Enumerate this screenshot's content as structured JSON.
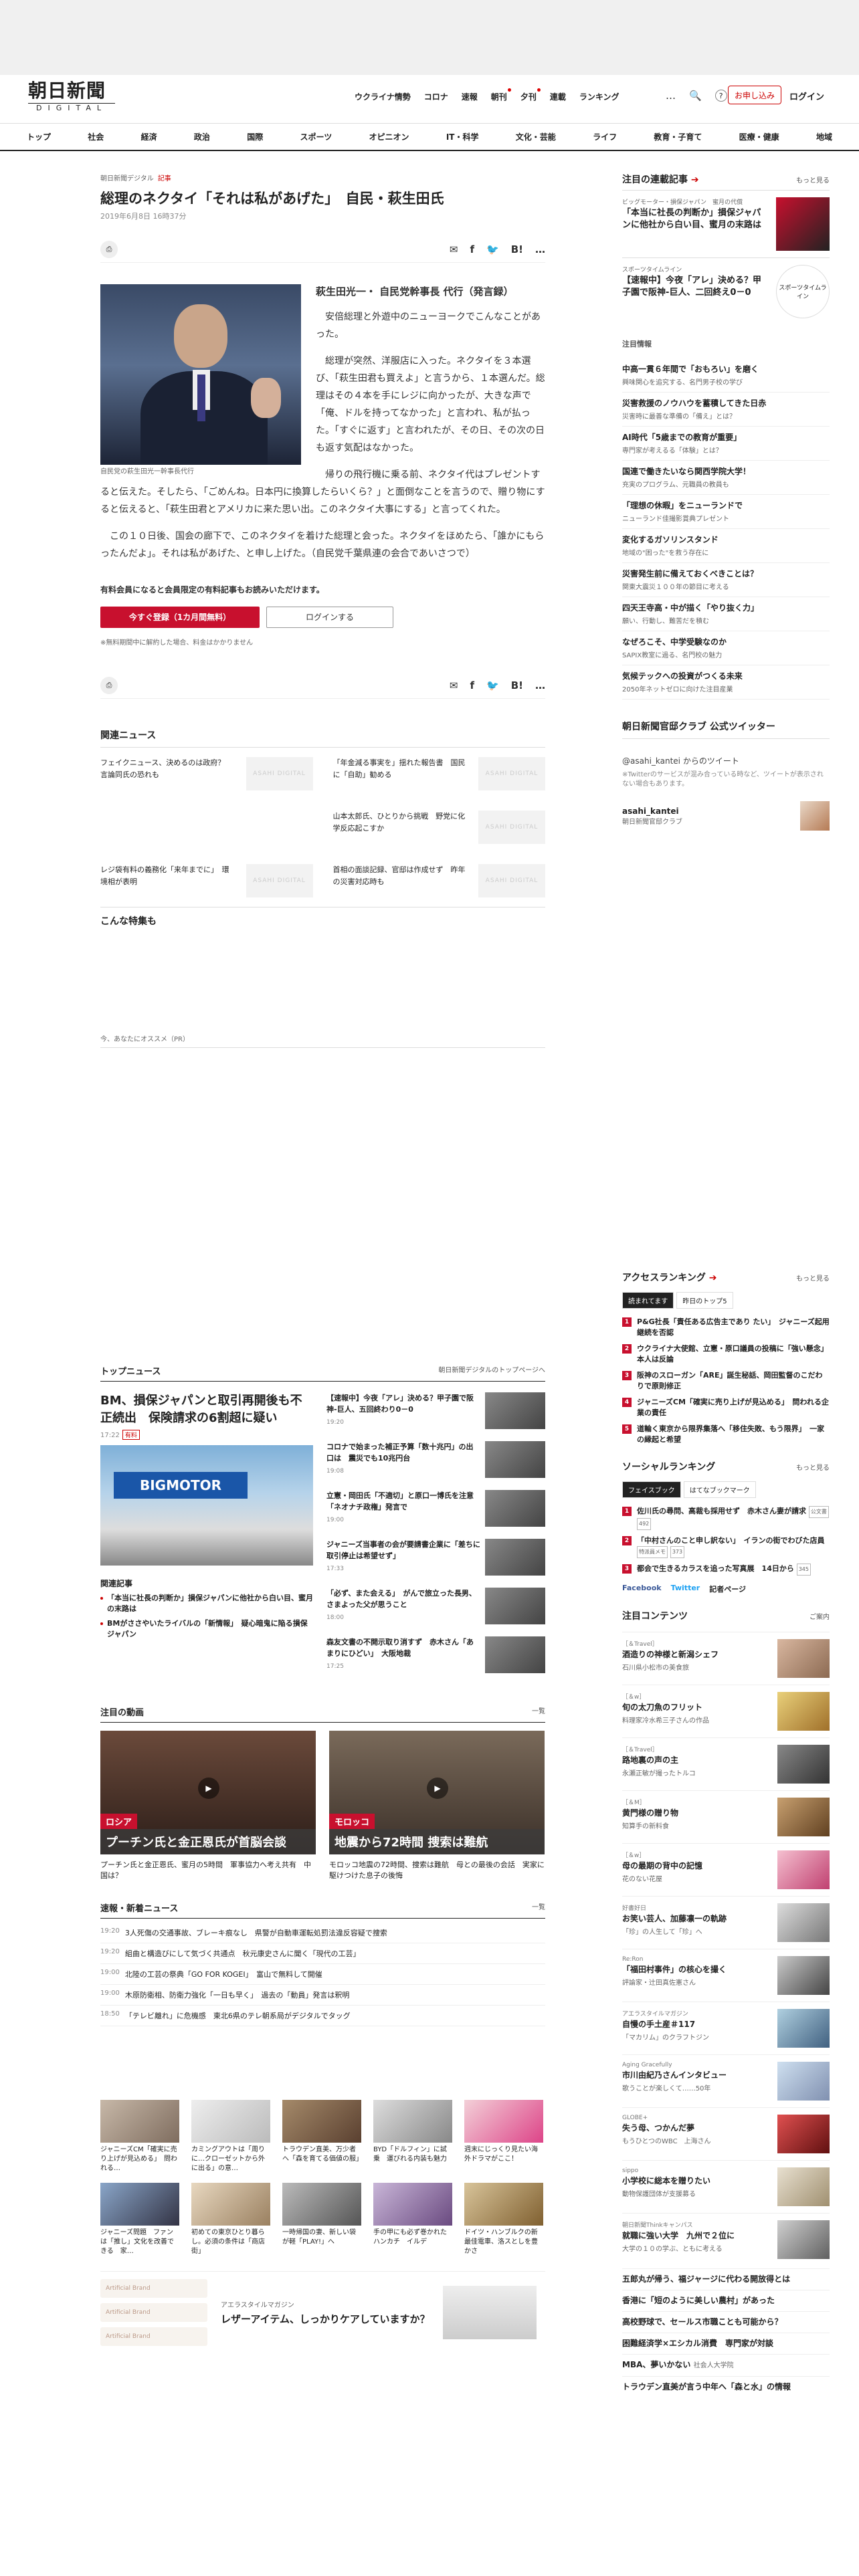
{
  "header": {
    "logo_main": "朝日新聞",
    "logo_sub": "DIGITAL",
    "nav": [
      "ウクライナ情勢",
      "コロナ",
      "速報",
      "朝刊",
      "夕刊",
      "連載",
      "ランキング"
    ],
    "more": "…",
    "search_icon": "🔍",
    "help_icon": "?",
    "signup": "お申し込み",
    "login": "ログイン"
  },
  "catnav": [
    "トップ",
    "社会",
    "経済",
    "政治",
    "国際",
    "スポーツ",
    "オピニオン",
    "IT・科学",
    "文化・芸能",
    "ライフ",
    "教育・子育て",
    "医療・健康",
    "地域"
  ],
  "article": {
    "crumb": "朝日新聞デジタル",
    "crumb_kind": "記事",
    "title": "総理のネクタイ「それは私があげた」　自民・萩生田氏",
    "date": "2019年6月8日 16時37分",
    "share": {
      "print": "⎙",
      "mail": "✉",
      "fb": "f",
      "tw": "🐦",
      "hatena": "B!",
      "more": "…",
      "list": "list"
    },
    "photo_caption": "自民党の萩生田光一幹事長代行",
    "subhead": "萩生田光一・ 自民党幹事長 代行（発言録）",
    "paragraphs": [
      "安倍総理と外遊中のニューヨークでこんなことがあった。",
      "総理が突然、洋服店に入った。ネクタイを３本選び、「萩生田君も買えよ」と言うから、１本選んだ。総理はその４本を手にレジに向かったが、大きな声で「俺、ドルを持ってなかった」と言われ、私が払った。「すぐに返す」と言われたが、その日、その次の日も返す気配はなかった。",
      "帰りの飛行機に乗る前、ネクタイ代はプレゼントすると伝えた。そしたら、「ごめんね。日本円に換算したらいくら？」と面倒なことを言うので、贈り物にすると伝えると、「萩生田君とアメリカに来た思い出。このネクタイ大事にする」と言ってくれた。",
      "この１０日後、国会の廊下で、このネクタイを着けた総理と会った。ネクタイをほめたら、「誰かにもらったんだよ」。それは私があげた、と申し上げた。（自民党千葉県連の会合であいさつで）"
    ],
    "paywall": {
      "msg": "有料会員になると会員限定の有料記事もお読みいただけます。",
      "signup": "今すぐ登録（1カ月間無料）",
      "login": "ログインする",
      "note": "※無料期間中に解約した場合、料金はかかりません"
    }
  },
  "related": {
    "title": "関連ニュース",
    "items": [
      "フェイクニュース、決めるのは政府？　言論同氏の恐れも",
      "「年金減る事実を」揺れた報告書　国民に「自助」勧める",
      "",
      "山本太郎氏、ひとりから挑戦　野党に化学反応起こすか",
      "レジ袋有料の義務化「来年までに」　環境相が表明",
      "首相の面談記録、官邸は作成せず　昨年の災害対応時も"
    ],
    "thumb": "ASAHI DIGITAL"
  },
  "special": {
    "title": "こんな特集も",
    "pr": "今、あなたにオススメ（PR）"
  },
  "topnews": {
    "title": "トップニュース",
    "link": "朝日新聞デジタルのトップページへ",
    "lead": "BM、損保ジャパンと取引再開後も不正続出　保険請求の6割超に疑い",
    "lead_time": "17:22",
    "lead_badge": "有料",
    "img_text": "BIGMOTOR",
    "rel_title": "関連記事",
    "rel": [
      "「本当に社長の判断か」損保ジャパンに他社から白い目、蜜月の末路は",
      "BMがささやいたライバルの「新情報」　疑心暗鬼に陥る損保ジャパン"
    ],
    "right": [
      {
        "t": "【速報中】今夜「アレ」決める？甲子園で阪神-巨人、五回終わり0－0",
        "m": "19:20"
      },
      {
        "t": "コロナで始まった補正予算「数十兆円」の出口は　震災でも10兆円台",
        "m": "19:08"
      },
      {
        "t": "立憲・岡田氏「不適切」と原口一博氏を注意　「ネオナチ政権」発言で",
        "m": "19:00"
      },
      {
        "t": "ジャニーズ当事者の会が要請書企業に「差ちに取引停止は希望せず」",
        "m": "17:33"
      },
      {
        "t": "「必ず、また会える」　がんで旅立った長男、さまよった父が思うこと",
        "m": "18:00"
      },
      {
        "t": "森友文書の不開示取り消すず　赤木さん「あまりにひどい」　大阪地裁",
        "m": "17:25"
      }
    ]
  },
  "videos": {
    "title": "注目の動画",
    "more": "一覧",
    "items": [
      {
        "tag": "ロシア",
        "bar": "プーチン氏と金正恩氏が首脳会談",
        "cap": "プーチン氏と金正恩氏、蜜月の5時間　軍事協力へ考え共有　中国は？"
      },
      {
        "tag": "モロッコ",
        "bar": "地震から72時間 捜索は難航",
        "cap": "モロッコ地震の72時間、捜索は難航　母との最後の会話　実家に駆けつけた息子の後悔"
      }
    ]
  },
  "breaking": {
    "title": "速報・新着ニュース",
    "more": "一覧",
    "items": [
      {
        "tm": "19:20",
        "t": "3人死傷の交通事故、ブレーキ痕なし　県警が自動車運転処罰法違反容疑で捜索"
      },
      {
        "tm": "19:20",
        "t": "組曲と構造びにして気づく共通点　秋元康史さんに聞く「現代の工芸」"
      },
      {
        "tm": "19:00",
        "t": "北陸の工芸の祭典「GO FOR KOGEI」　富山で無料して開催"
      },
      {
        "tm": "19:00",
        "t": "木原防衛相、防衛力強化「一日も早く」　過去の「動員」発言は釈明"
      },
      {
        "tm": "18:50",
        "t": "「テレビ離れ」に危機感　東北6県のテレ朝系局がデジタルでタッグ"
      }
    ]
  },
  "promo": [
    "ジャニーズCM「確実に売り上げが見込める」　問われる…",
    "カミングアウトは「周りに…クローゼットから外に出る」の意…",
    "トラウデン直美、万少者へ「森を育てる価値の服」",
    "BYD「ドルフィン」に試乗　運びれる内装も魅力",
    "週末にじっくり見たい海外ドラマがここ！",
    "ジャニーズ問題　ファンは「推し」文化を改善できる　家…",
    "初めての東京ひとり暮らし。必須の条件は「商店街」",
    "一時帰国の妻、新しい袋が軽「PLAY!」へ",
    "手の甲にも必ず巻かれたハンカチ　イルデ",
    "ドイツ・ハンブルクの新最佳電車、洛スとしを豊かさ"
  ],
  "ad": {
    "brand": "Artificial Brand",
    "sub": "アエラスタイルマガジン",
    "head": "レザーアイテム、しっかりケアしていますか？"
  },
  "side": {
    "series_title": "注目の連載記事",
    "more": "もっと見る",
    "features": [
      {
        "sm": "ビッグモーター・損保ジャパン　蜜月の代償",
        "b": "「本当に社長の判断か」損保ジャパンに他社から白い目、蜜月の末路は"
      },
      {
        "sm": "スポーツタイムライン",
        "b": "【速報中】今夜「アレ」決める？甲子園で阪神-巨人、二回終え0－0",
        "pic": "スポーツタイムライン"
      }
    ],
    "cat": "注目情報",
    "list": [
      {
        "b": "中高一貫６年間で「おもろい」を磨く",
        "s": "興味関心を追究する、名門男子校の学び"
      },
      {
        "b": "災害救援のノウハウを蓄積してきた日赤",
        "s": "災害時に最善な準備の「備え」とは？"
      },
      {
        "b": "AI時代「5歳までの教育が重要」",
        "s": "専門家が考えるる「体験」とは？"
      },
      {
        "b": "国連で働きたいなら関西学院大学！",
        "s": "充実のプログラム、元職員の教員も"
      },
      {
        "b": "「理想の休暇」をニューランドで",
        "s": "ニューランド佳撮影賞典プレゼント"
      },
      {
        "b": "変化するガソリンスタンド",
        "s": "地域の\"困った\"を救う存在に"
      },
      {
        "b": "災害発生前に備えておくべきことは？",
        "s": "関東大震災１００年の節目に考える"
      },
      {
        "b": "四天王寺高・中が描く「やり抜く力」",
        "s": "願い、行動し、難苦だを積む"
      },
      {
        "b": "なぜろこそ、中学受験なのか",
        "s": "SAPIX教室に過る、名門校の魅力"
      },
      {
        "b": "気候テックへの投資がつくる未来",
        "s": "2050年ネットゼロに向けた注目産業"
      }
    ],
    "tw_title": "朝日新聞官邸クラブ 公式ツイッター",
    "tw_sub": "@asahi_kantei からのツイート",
    "tw_note": "※Twitterのサービスが混み合っている時など、ツイートが表示されない場合もあります。",
    "tw_name": "asahi_kantei",
    "tw_desc": "朝日新聞官邸クラブ"
  },
  "access": {
    "title": "アクセスランキング",
    "more": "もっと見る",
    "tabs": [
      "読まれてます",
      "昨日のトップ5"
    ],
    "items": [
      "P&G社長「責任ある広告主であり たい」　ジャニーズ起用継続を否認",
      "ウクライナ大使館、立憲・原口議員の投稿に「強い懸念」　本人は反論",
      "阪神のスローガン「ARE」誕生秘話、岡田監督のこだわりで原則修正",
      "ジャニーズCM「確実に売り上げが見込める」　問われる企業の責任",
      "道輪く東京から限界集落へ「移住失敗、もう限界」　一家の縁起と希望"
    ]
  },
  "social_rank": {
    "title": "ソーシャルランキング",
    "more": "もっと見る",
    "tabs": [
      "フェイスブック",
      "はてなブックマーク"
    ],
    "items": [
      {
        "t": "佐川氏の尋問、高裁も採用せず　赤木さん妻が請求",
        "c": "公文書",
        "n": "492"
      },
      {
        "t": "「中村さんのこと申し訳ない」　イランの街でわびた店員",
        "c": "特派員メモ",
        "n": "373"
      },
      {
        "t": "都会で生きるカラスを追った写真展　14日から",
        "n": "345"
      }
    ],
    "sns": [
      "Facebook",
      "Twitter",
      "記者ページ"
    ]
  },
  "contents": {
    "title": "注目コンテンツ",
    "more": "ご案内",
    "items": [
      {
        "k": "［＆Travel］",
        "b": "酒造りの神様と新潟シェフ",
        "s": "石川県小松市の美食旅"
      },
      {
        "k": "［＆w］",
        "b": "旬の太刀魚のフリット",
        "s": "料理家冷水希三子さんの作品"
      },
      {
        "k": "［＆Travel］",
        "b": "路地裏の声の主",
        "s": "永瀬正敏が撮ったトルコ"
      },
      {
        "k": "［＆M］",
        "b": "黄門様の贈り物",
        "s": "知算手の新料食"
      },
      {
        "k": "［＆w］",
        "b": "母の最期の背中の記憶",
        "s": "花のない花屋"
      },
      {
        "k": "好書好日",
        "b": "お笑い芸人、加藤凛一の軌跡",
        "s": "「珍」の人生して「珍」へ"
      },
      {
        "k": "Re:Ron",
        "b": "「福田村事件」の核心を撮く",
        "s": "評論家・辻田真佐憲さん"
      },
      {
        "k": "アエラスタイルマガジン",
        "b": "自慢の手土産＃117",
        "s": "「マカリム」のクラフトジン"
      },
      {
        "k": "Aging Gracefully",
        "b": "市川由紀乃さんインタビュー",
        "s": "歌うことが楽しくて……50年"
      },
      {
        "k": "GLOBE+",
        "b": "失う母、つかんだ夢",
        "s": "もうひとつのWBC　上海さん"
      },
      {
        "k": "sippo",
        "b": "小学校に総本を贈りたい",
        "s": "動物保護団体が支援募る"
      },
      {
        "k": "朝日新聞Thinkキャンパス",
        "b": "就職に強い大学　九州で２位に",
        "s": "大学の１０の学ぶ、ともに考える"
      }
    ],
    "plain": [
      {
        "b": "五郎丸が帰う、福ジャージに代わる開放得とは"
      },
      {
        "b": "香港に「短のように美しい農村」があった"
      },
      {
        "b": "高校野球で、セールス市職ことも可能から？"
      },
      {
        "b": "困難経済学×エシカル消費　専門家が対談"
      },
      {
        "b": "MBA、夢いかない",
        "s": "社会人大学院"
      },
      {
        "b": "トラウデン直美が言う中年へ「森と水」の情報"
      }
    ]
  }
}
